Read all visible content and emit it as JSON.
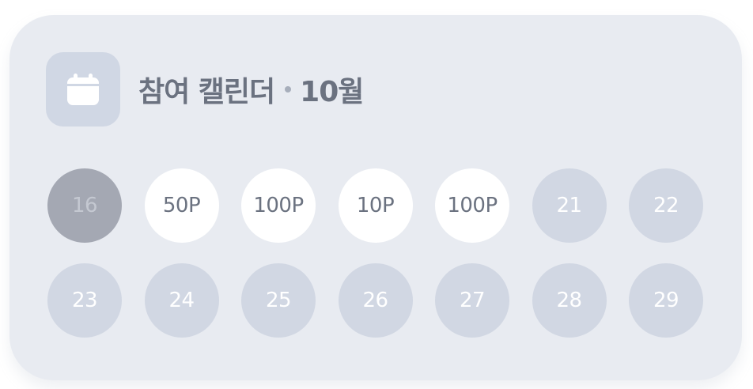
{
  "widget": {
    "title": "참여 캘린더",
    "month": "10월",
    "icon": "calendar-icon"
  },
  "days": [
    {
      "label": "16",
      "state": "past"
    },
    {
      "label": "50P",
      "state": "earned"
    },
    {
      "label": "100P",
      "state": "earned"
    },
    {
      "label": "10P",
      "state": "earned"
    },
    {
      "label": "100P",
      "state": "earned"
    },
    {
      "label": "21",
      "state": "future"
    },
    {
      "label": "22",
      "state": "future"
    },
    {
      "label": "23",
      "state": "future"
    },
    {
      "label": "24",
      "state": "future"
    },
    {
      "label": "25",
      "state": "future"
    },
    {
      "label": "26",
      "state": "future"
    },
    {
      "label": "27",
      "state": "future"
    },
    {
      "label": "28",
      "state": "future"
    },
    {
      "label": "29",
      "state": "future"
    }
  ],
  "colors": {
    "card": "#e8ebf1",
    "past": "#a4a8b3",
    "earned": "#ffffff",
    "future": "#d1d7e3",
    "title": "#6b7280"
  }
}
